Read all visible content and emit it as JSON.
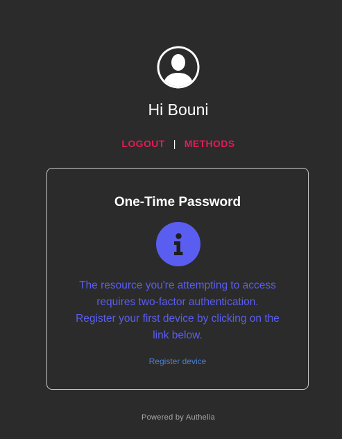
{
  "user": {
    "greeting": "Hi Bouni"
  },
  "nav": {
    "logout_label": "LOGOUT",
    "separator": "|",
    "methods_label": "METHODS"
  },
  "card": {
    "title": "One-Time Password",
    "message_lines": [
      "The resource you're attempting to access",
      "requires two-factor authentication.",
      "Register your first device by clicking on the",
      "link below."
    ],
    "register_link": "Register device"
  },
  "footer": {
    "powered_by": "Powered by Authelia"
  },
  "icons": {
    "avatar": "user-avatar-icon",
    "info": "info-icon"
  },
  "colors": {
    "background": "#2b2b2b",
    "accent_link": "#e01e56",
    "message_text": "#5a5ef0",
    "info_circle": "#5a5ef0",
    "register_link": "#4a7fd1"
  }
}
